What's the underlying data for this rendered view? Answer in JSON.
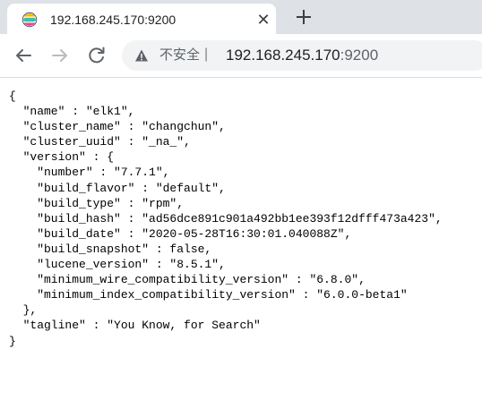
{
  "browser": {
    "tab": {
      "title": "192.168.245.170:9200",
      "close_glyph": "✕",
      "new_tab_glyph": "+"
    },
    "toolbar": {
      "security_label": "不安全",
      "separator": "|",
      "url_host": "192.168.245.170",
      "url_port": ":9200"
    },
    "icons": [
      "elastic-favicon-icon",
      "close-icon",
      "plus-icon",
      "back-arrow-icon",
      "forward-arrow-icon",
      "reload-icon",
      "warning-icon"
    ]
  },
  "json_lines": [
    "{",
    "  \"name\" : \"elk1\",",
    "  \"cluster_name\" : \"changchun\",",
    "  \"cluster_uuid\" : \"_na_\",",
    "  \"version\" : {",
    "    \"number\" : \"7.7.1\",",
    "    \"build_flavor\" : \"default\",",
    "    \"build_type\" : \"rpm\",",
    "    \"build_hash\" : \"ad56dce891c901a492bb1ee393f12dfff473a423\",",
    "    \"build_date\" : \"2020-05-28T16:30:01.040088Z\",",
    "    \"build_snapshot\" : false,",
    "    \"lucene_version\" : \"8.5.1\",",
    "    \"minimum_wire_compatibility_version\" : \"6.8.0\",",
    "    \"minimum_index_compatibility_version\" : \"6.0.0-beta1\"",
    "  },",
    "  \"tagline\" : \"You Know, for Search\"",
    "}"
  ]
}
